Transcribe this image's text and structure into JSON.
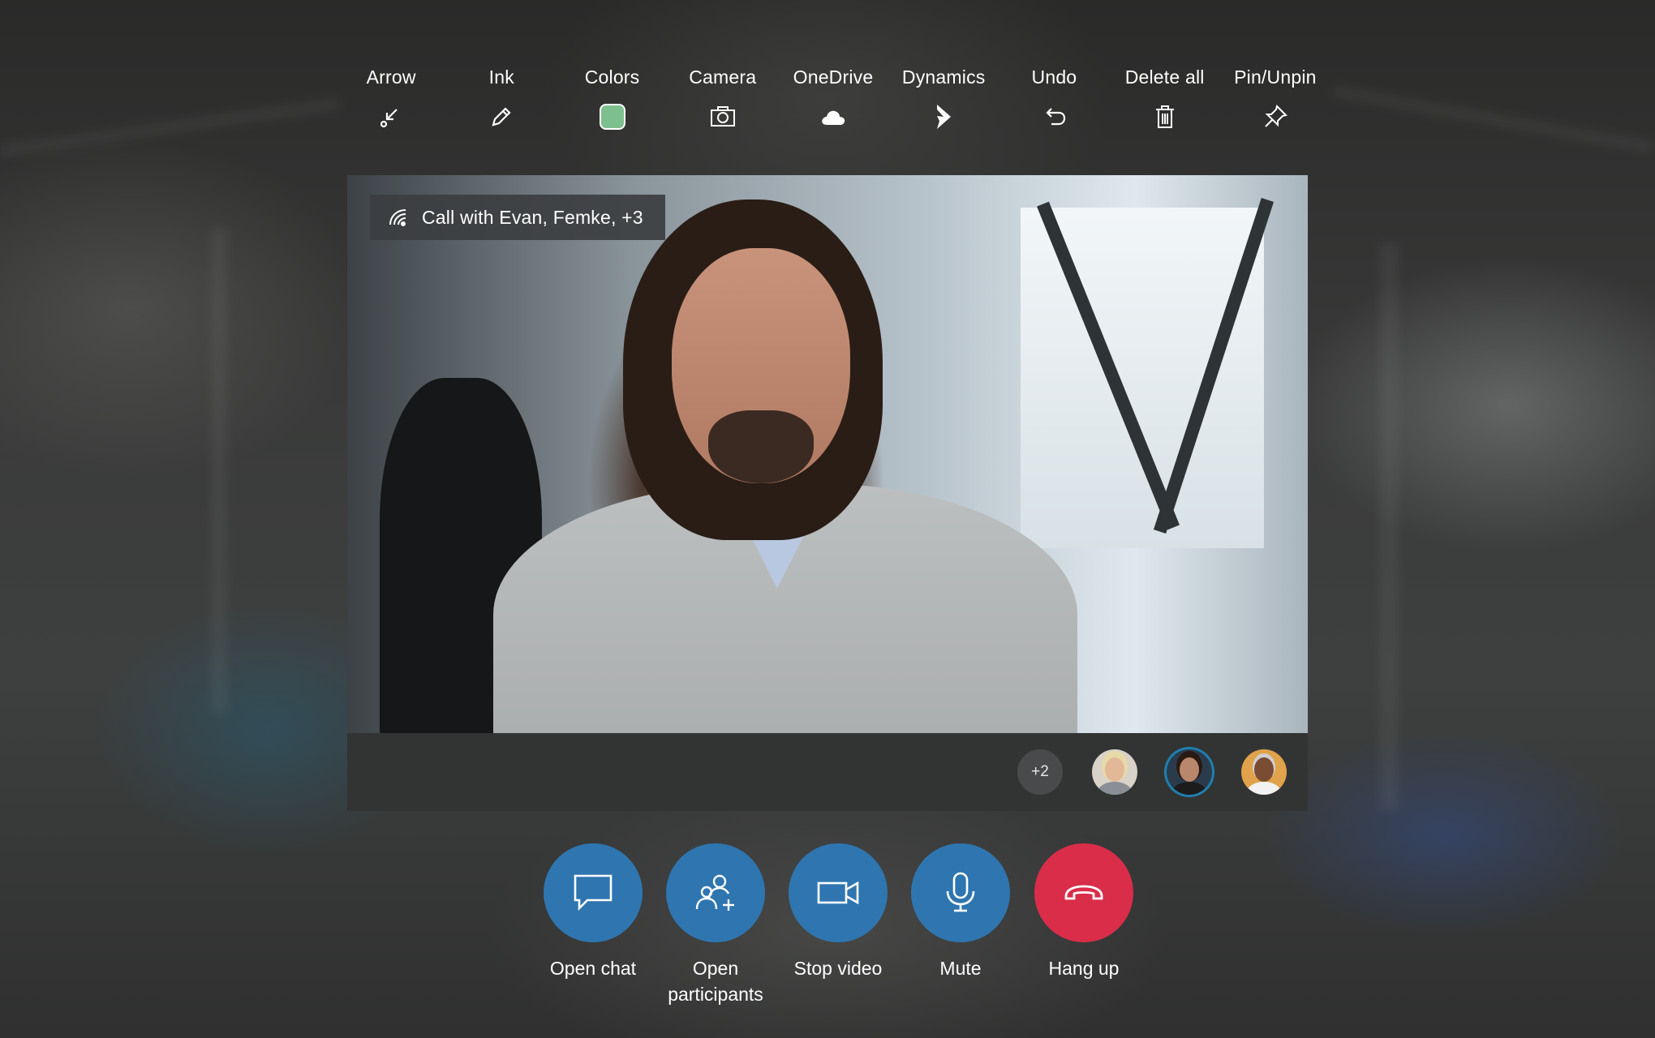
{
  "toolbar": {
    "items": [
      {
        "label": "Arrow",
        "icon": "arrow-icon"
      },
      {
        "label": "Ink",
        "icon": "pen-icon"
      },
      {
        "label": "Colors",
        "icon": "color-swatch"
      },
      {
        "label": "Camera",
        "icon": "camera-icon"
      },
      {
        "label": "OneDrive",
        "icon": "cloud-icon"
      },
      {
        "label": "Dynamics",
        "icon": "dynamics-icon"
      },
      {
        "label": "Undo",
        "icon": "undo-icon"
      },
      {
        "label": "Delete all",
        "icon": "trash-icon"
      },
      {
        "label": "Pin/Unpin",
        "icon": "pin-icon"
      }
    ],
    "selected_color": "#7dc08e"
  },
  "call": {
    "title": "Call with Evan, Femke, +3",
    "icon": "signal-icon"
  },
  "participants": {
    "more_count": "+2",
    "active_ring_color": "#1f7fae"
  },
  "controls": {
    "open_chat": "Open chat",
    "open_participants_line1": "Open",
    "open_participants_line2": "participants",
    "stop_video": "Stop video",
    "mute": "Mute",
    "hang_up": "Hang up",
    "primary_color": "#2f76b0",
    "hangup_color": "#d92d4a"
  }
}
